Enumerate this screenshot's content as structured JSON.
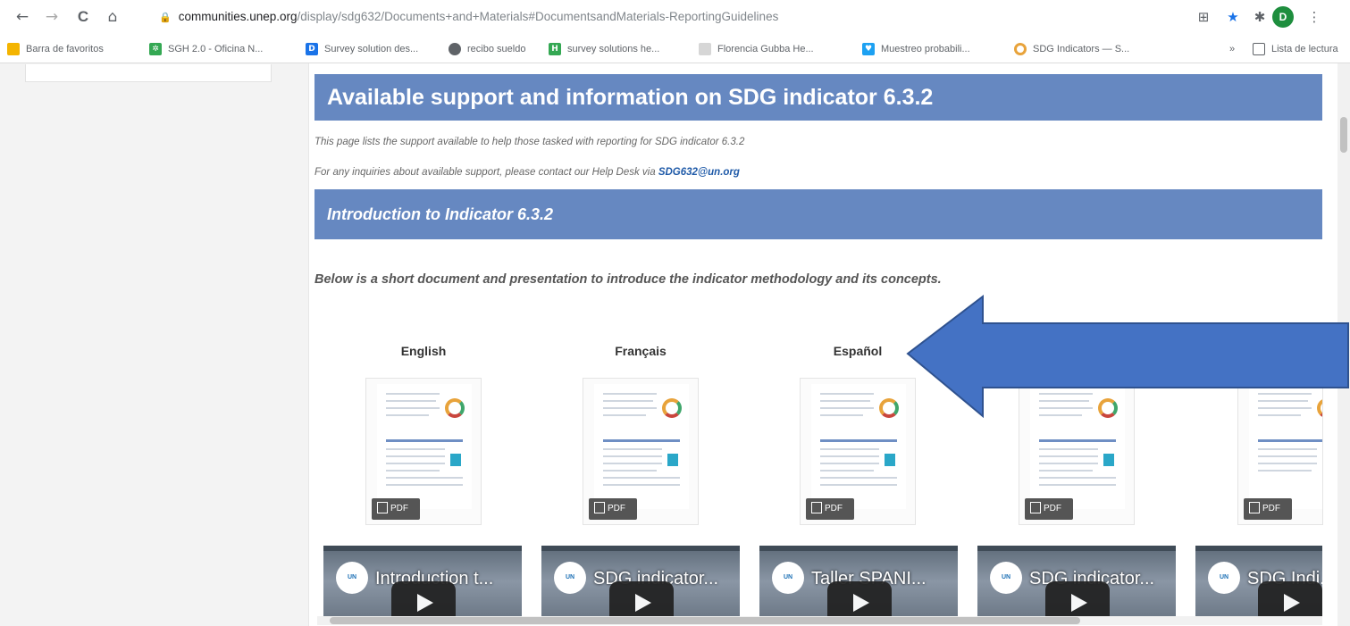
{
  "browser": {
    "nav": {
      "back": "←",
      "forward": "→",
      "reload": "C",
      "home": "⌂"
    },
    "url_host": "communities.unep.org",
    "url_path": "/display/sdg632/Documents+and+Materials#DocumentsandMaterials-ReportingGuidelines",
    "profile_initial": "D",
    "bookmarks": [
      {
        "label": "Barra de favoritos",
        "icon": "folder-icon",
        "color": "#f4b400"
      },
      {
        "label": "SGH 2.0 - Oficina N...",
        "icon": "bug-icon",
        "color": "#34a853"
      },
      {
        "label": "Survey solution des...",
        "icon": "d-icon",
        "color": "#1a73e8"
      },
      {
        "label": "recibo sueldo",
        "icon": "globe-icon",
        "color": "#5f6368"
      },
      {
        "label": "survey solutions he...",
        "icon": "h-icon",
        "color": "#34a853"
      },
      {
        "label": "Florencia Gubba He...",
        "icon": "leaf-icon",
        "color": "#c9c9c9"
      },
      {
        "label": "Muestreo probabili...",
        "icon": "heart-icon",
        "color": "#1da1f2"
      },
      {
        "label": "SDG Indicators — S...",
        "icon": "sdg-icon",
        "color": "#e8a33b"
      }
    ],
    "more_bookmarks": "»",
    "reading_list": "Lista de lectura"
  },
  "page": {
    "title": "Available support and information on SDG indicator 6.3.2",
    "note_1": "This page lists the support available to help those tasked with reporting for SDG indicator 6.3.2",
    "note_2_prefix": "For any inquiries about available support, please contact our Help Desk via ",
    "note_2_email": "SDG632@un.org",
    "section_title": "Introduction to Indicator 6.3.2",
    "intro": "Below is a short document and presentation to introduce the indicator methodology and its concepts.",
    "languages": [
      "English",
      "Français",
      "Español"
    ],
    "pdf_label": "PDF",
    "videos": [
      "Introduction t...",
      "SDG indicator...",
      "Taller SPANI...",
      "SDG indicator...",
      "SDG Indi..."
    ]
  },
  "annotation": {
    "arrow_color": "#4472c4"
  }
}
